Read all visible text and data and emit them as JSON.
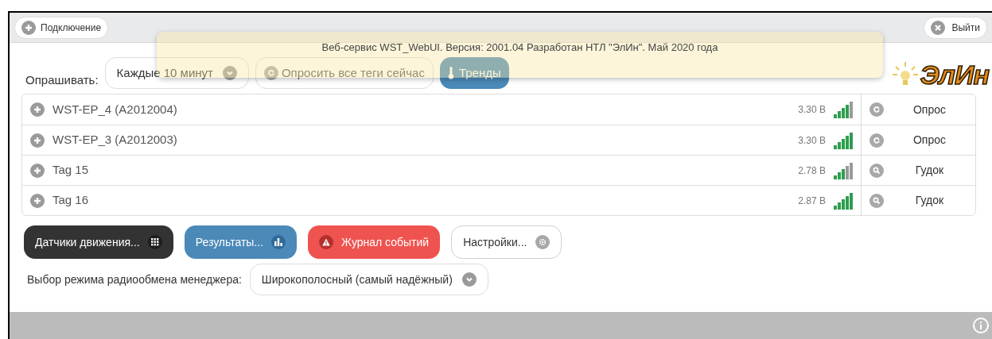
{
  "top_bar": {
    "connect_button": "Подключение",
    "logout_button": "Выйти"
  },
  "toast": {
    "text": "Веб-сервис WST_WebUI. Версия: 2001.04 Разработан НТЛ \"ЭлИн\". Май 2020 года"
  },
  "logo": {
    "text": "ЭлИн"
  },
  "toolbar": {
    "label": "Опрашивать:",
    "interval_select": "Каждые 10 минут",
    "poll_button": "Опросить все теги сейчас",
    "trends_button": "Тренды"
  },
  "tags": [
    {
      "name": "WST-EP_4 (A2012004)",
      "voltage": "3.30 В",
      "level": 0.8,
      "kind": "refresh",
      "action": "Опрос"
    },
    {
      "name": "WST-EP_3 (A2012003)",
      "voltage": "3.30 В",
      "level": 1,
      "kind": "refresh",
      "action": "Опрос"
    },
    {
      "name": "Tag 15",
      "voltage": "2.78 В",
      "level": 0.6,
      "kind": "search",
      "action": "Гудок"
    },
    {
      "name": "Tag 16",
      "voltage": "2.87 В",
      "level": 1,
      "kind": "search",
      "action": "Гудок"
    }
  ],
  "buttons": [
    {
      "kind": "sensors",
      "label": "Датчики движения..."
    },
    {
      "kind": "results",
      "label": "Результаты..."
    },
    {
      "kind": "journal",
      "label": "Журнал событий"
    },
    {
      "kind": "settings",
      "label": "Настройки..."
    }
  ],
  "radio_mode": {
    "label": "Выбор режима радиообмена менеджера:",
    "value": "Широкополосный (самый надёжный)"
  }
}
